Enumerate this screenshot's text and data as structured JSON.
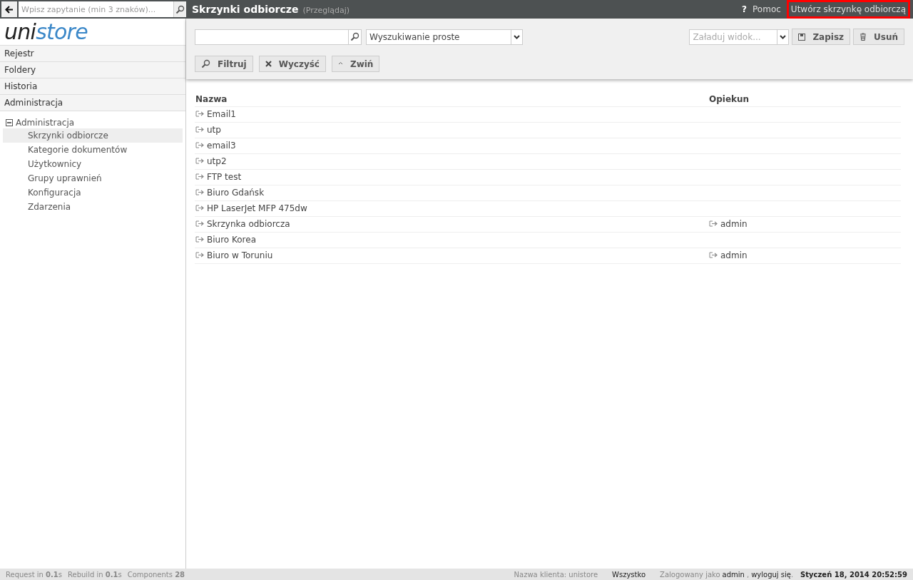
{
  "search": {
    "placeholder": "Wpisz zapytanie (min 3 znaków)..."
  },
  "logo": {
    "dark": "uni",
    "accent": "store"
  },
  "nav": [
    "Rejestr",
    "Foldery",
    "Historia",
    "Administracja"
  ],
  "tree": {
    "label": "Administracja",
    "expanded": true,
    "children": [
      {
        "label": "Skrzynki odbiorcze",
        "selected": true
      },
      {
        "label": "Kategorie dokumentów",
        "selected": false
      },
      {
        "label": "Użytkownicy",
        "selected": false
      },
      {
        "label": "Grupy uprawnień",
        "selected": false
      },
      {
        "label": "Konfiguracja",
        "selected": false
      },
      {
        "label": "Zdarzenia",
        "selected": false
      }
    ]
  },
  "header": {
    "title": "Skrzynki odbiorcze",
    "subtitle": "(Przeglądaj)",
    "help": "?",
    "help_label": "Pomoc",
    "create": "Utwórz skrzynkę odbiorczą",
    "create_highlighted": true
  },
  "toolbar": {
    "search_mode": "Wyszukiwanie proste",
    "view_placeholder": "Załaduj widok...",
    "save": "Zapisz",
    "delete": "Usuń",
    "filter": "Filtruj",
    "clear": "Wyczyść",
    "collapse": "Zwiń"
  },
  "table": {
    "columns": [
      "Nazwa",
      "Opiekun"
    ],
    "rows": [
      {
        "name": "Email1"
      },
      {
        "name": "utp"
      },
      {
        "name": "email3"
      },
      {
        "name": "utp2"
      },
      {
        "name": "FTP test"
      },
      {
        "name": "Biuro Gdańsk"
      },
      {
        "name": "HP LaserJet MFP 475dw"
      },
      {
        "name": "Skrzynka odbiorcza",
        "owner": "admin"
      },
      {
        "name": "Biuro Korea"
      },
      {
        "name": "Biuro w Toruniu",
        "owner": "admin"
      }
    ]
  },
  "status_bar": {
    "stats": [
      "Request in **0.1**s",
      "Rebuild in **0.1**s",
      "Components **28**"
    ],
    "client": "Nazwa klienta: unistore",
    "scope": "Wszystko",
    "logged_as": "Zalogowany jako",
    "user": "admin",
    "separator": ",",
    "logout": "wyloguj się",
    "period": ".",
    "datetime": "Styczeń 18, 2014 20:52:59"
  }
}
